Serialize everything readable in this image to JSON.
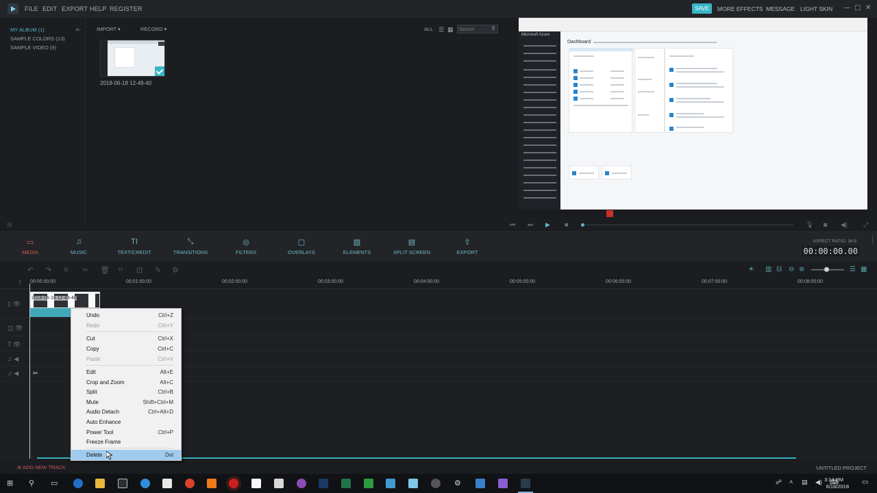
{
  "titlebar": {
    "menus": [
      "FILE",
      "EDIT",
      "EXPORT",
      "HELP",
      "REGISTER"
    ],
    "save": "SAVE",
    "right_menus": [
      "MORE EFFECTS",
      "MESSAGE",
      "LIGHT SKIN"
    ]
  },
  "library": {
    "items": [
      "MY ALBUM (1)",
      "SAMPLE COLORS (13)",
      "SAMPLE VIDEO (9)"
    ],
    "import": "IMPORT",
    "record": "RECORD",
    "filter": "ALL",
    "search_placeholder": "Search",
    "media": [
      {
        "label": "2018-06-18 12-49-40"
      }
    ]
  },
  "preview": {
    "app_header": "Microsoft Azure",
    "dashboard_title": "Dashboard"
  },
  "tabs": [
    {
      "label": "MEDIA",
      "icon": "▭",
      "active": true
    },
    {
      "label": "MUSIC",
      "icon": "♫"
    },
    {
      "label": "TEXT/CREDIT",
      "icon": "TI"
    },
    {
      "label": "TRANSITIONS",
      "icon": "⤡"
    },
    {
      "label": "FILTERS",
      "icon": "◎"
    },
    {
      "label": "OVERLAYS",
      "icon": "▢"
    },
    {
      "label": "ELEMENTS",
      "icon": "▨"
    },
    {
      "label": "SPLIT SCREEN",
      "icon": "▤"
    },
    {
      "label": "EXPORT",
      "icon": "⇪"
    }
  ],
  "aspect_ratio": "ASPECT RATIO: 16:9",
  "timecode": "00:00:00.00",
  "ruler": [
    "00:00:00:00",
    "00:01:00:00",
    "00:02:00:00",
    "00:03:00:00",
    "00:04:00:00",
    "00:05:00:00",
    "00:06:00:00",
    "00:07:00:00",
    "00:08:00:00"
  ],
  "clip": {
    "label": "2018-06-18 12-49-40"
  },
  "context_menu": [
    {
      "label": "Undo",
      "shortcut": "Ctrl+Z"
    },
    {
      "label": "Redo",
      "shortcut": "Ctrl+Y",
      "disabled": true
    },
    {
      "label": "Cut",
      "shortcut": "Ctrl+X"
    },
    {
      "label": "Copy",
      "shortcut": "Ctrl+C"
    },
    {
      "label": "Paste",
      "shortcut": "Ctrl+V",
      "disabled": true
    },
    {
      "label": "Edit",
      "shortcut": "Alt+E"
    },
    {
      "label": "Crop and Zoom",
      "shortcut": "Alt+C"
    },
    {
      "label": "Split",
      "shortcut": "Ctrl+B"
    },
    {
      "label": "Mute",
      "shortcut": "Shift+Ctrl+M"
    },
    {
      "label": "Audio Detach",
      "shortcut": "Ctrl+Alt+D"
    },
    {
      "label": "Auto Enhance",
      "shortcut": ""
    },
    {
      "label": "Power Tool",
      "shortcut": "Ctrl+P"
    },
    {
      "label": "Freeze Frame",
      "shortcut": ""
    },
    {
      "label": "Delete",
      "shortcut": "Del",
      "selected": true
    }
  ],
  "status": {
    "add_track": "ADD NEW TRACK",
    "project": "UNTITLED PROJECT"
  },
  "taskbar": {
    "time": "3:14 PM",
    "date": "6/18/2018"
  },
  "colors": {
    "accent": "#38b6c5",
    "active_tab": "#e05a4e",
    "menu_select": "#9fcbef"
  }
}
